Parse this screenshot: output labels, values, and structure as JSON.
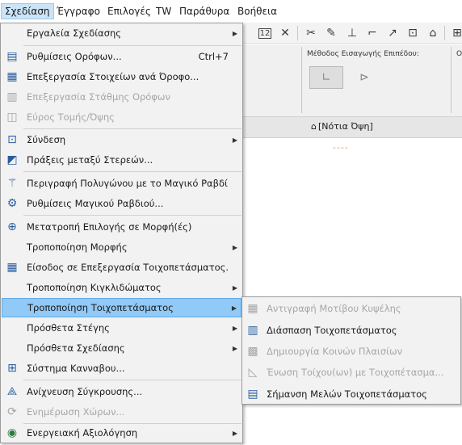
{
  "menubar": {
    "items": [
      "Σχεδίαση",
      "Έγγραφο",
      "Επιλογές",
      "TW",
      "Παράθυρα",
      "Βοήθεια"
    ]
  },
  "infobox": {
    "method_label": "Μέθοδος Εισαγωγής Επιπέδου:",
    "right_label": "Ο"
  },
  "tabs": {
    "south_view": "[Νότια Όψη]"
  },
  "drawing": {
    "dashes": "----"
  },
  "menu": {
    "items": [
      {
        "label": "Εργαλεία Σχεδίασης",
        "icon": "none",
        "submenu": true,
        "disabled": false
      },
      {
        "label": "Ρυθμίσεις Ορόφων...",
        "icon": "story-settings-icon",
        "shortcut": "Ctrl+7",
        "disabled": false
      },
      {
        "label": "Επεξεργασία Στοιχείων ανά Όροφο...",
        "icon": "edit-by-story-icon",
        "disabled": false
      },
      {
        "label": "Επεξεργασία Στάθμης Ορόφων",
        "icon": "story-levels-icon",
        "disabled": true
      },
      {
        "label": "Εύρος Τομής/Όψης",
        "icon": "section-range-icon",
        "disabled": true
      },
      {
        "label": "Σύνδεση",
        "icon": "connect-icon",
        "submenu": true,
        "disabled": false
      },
      {
        "label": "Πράξεις μεταξύ Στερεών...",
        "icon": "solid-operations-icon",
        "disabled": false
      },
      {
        "label": "Περιγραφή Πολυγώνου με το Μαγικό Ραβδί",
        "icon": "magic-wand-icon",
        "disabled": false
      },
      {
        "label": "Ρυθμίσεις Μαγικού Ραβδιού...",
        "icon": "magic-wand-settings-icon",
        "disabled": false
      },
      {
        "label": "Μετατροπή Επιλογής σε Μορφή(ές)",
        "icon": "convert-to-morph-icon",
        "disabled": false
      },
      {
        "label": "Τροποποίηση Μορφής",
        "icon": "none",
        "submenu": true,
        "disabled": false
      },
      {
        "label": "Είσοδος σε Επεξεργασία Τοιχοπετάσματος.",
        "icon": "curtain-wall-edit-icon",
        "disabled": false
      },
      {
        "label": "Τροποποίηση Κιγκλιδώματος",
        "icon": "none",
        "submenu": true,
        "disabled": false
      },
      {
        "label": "Τροποποίηση Τοιχοπετάσματος",
        "icon": "none",
        "submenu": true,
        "disabled": false,
        "highlight": true
      },
      {
        "label": "Πρόσθετα Στέγης",
        "icon": "none",
        "submenu": true,
        "disabled": false
      },
      {
        "label": "Πρόσθετα Σχεδίασης",
        "icon": "none",
        "submenu": true,
        "disabled": false
      },
      {
        "label": "Σύστημα Κανναβου...",
        "icon": "grid-system-icon",
        "disabled": false
      },
      {
        "label": "Ανίχνευση Σύγκρουσης...",
        "icon": "collision-detection-icon",
        "disabled": false
      },
      {
        "label": "Ενημέρωση Χώρων...",
        "icon": "update-zones-icon",
        "disabled": true
      },
      {
        "label": "Ενεργειακή Αξιολόγηση",
        "icon": "energy-evaluation-icon",
        "submenu": true,
        "disabled": false
      }
    ]
  },
  "submenu": {
    "items": [
      {
        "label": "Αντιγραφή Μοτίβου Κυψέλης",
        "icon": "copy-cell-pattern-icon",
        "disabled": true
      },
      {
        "label": "Διάσπαση Τοιχοπετάσματος",
        "icon": "explode-curtain-wall-icon",
        "disabled": false
      },
      {
        "label": "Δημιουργία Κοινών Πλαισίων",
        "icon": "create-common-frames-icon",
        "disabled": true
      },
      {
        "label": "Ένωση Τοίχου(ων) με Τοιχοπέτασμα...",
        "icon": "merge-wall-icon",
        "disabled": true
      },
      {
        "label": "Σήμανση Μελών Τοιχοπετάσματος",
        "icon": "label-members-icon",
        "disabled": false
      }
    ]
  },
  "colors": {
    "menu_bg": "#f2f2f2",
    "highlight": "#91c9f7",
    "disabled_text": "#a6a6a6"
  }
}
